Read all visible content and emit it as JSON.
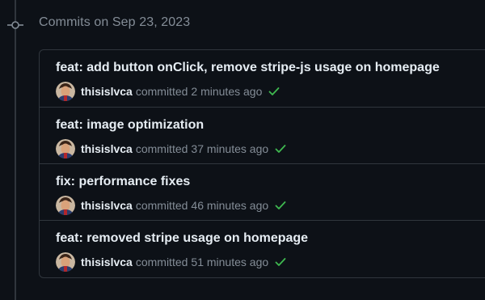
{
  "timeline": {
    "date_heading": "Commits on Sep 23, 2023",
    "node_icon": "git-commit-icon"
  },
  "commits": [
    {
      "title": "feat: add button onClick, remove stripe-js usage on homepage",
      "author": "thisislvca",
      "verb": "committed",
      "time": "2 minutes ago",
      "status": "success"
    },
    {
      "title": "feat: image optimization",
      "author": "thisislvca",
      "verb": "committed",
      "time": "37 minutes ago",
      "status": "success"
    },
    {
      "title": "fix: performance fixes",
      "author": "thisislvca",
      "verb": "committed",
      "time": "46 minutes ago",
      "status": "success"
    },
    {
      "title": "feat: removed stripe usage on homepage",
      "author": "thisislvca",
      "verb": "committed",
      "time": "51 minutes ago",
      "status": "success"
    }
  ],
  "colors": {
    "background": "#0d1117",
    "border": "#30363d",
    "text": "#e6edf3",
    "muted": "#848d97",
    "success": "#3fb950"
  }
}
